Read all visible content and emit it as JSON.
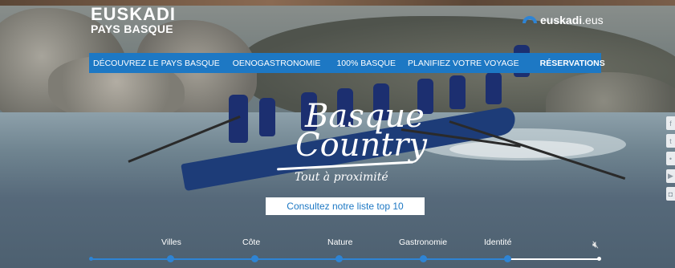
{
  "brand": {
    "line1": "EUSKADI",
    "line2": "PAYS BASQUE"
  },
  "site_link": {
    "bold": "euskadi",
    "suffix": ".eus",
    "color": "#2e84d4"
  },
  "nav": {
    "color": "#1d78c4",
    "items": [
      {
        "label": "DÉCOUVREZ LE PAYS BASQUE",
        "bold": false
      },
      {
        "label": "OENOGASTRONOMIE",
        "bold": false
      },
      {
        "label": "100% BASQUE",
        "bold": false
      },
      {
        "label": "PLANIFIEZ VOTRE VOYAGE",
        "bold": false
      },
      {
        "label": "RÉSERVATIONS",
        "bold": true
      }
    ]
  },
  "hero": {
    "title_line1": "Basque",
    "title_line2": "Country",
    "tagline": "Tout à proximité"
  },
  "cta": {
    "label": "Consultez notre liste top 10"
  },
  "timeline": {
    "items": [
      "Villes",
      "Côte",
      "Nature",
      "Gastronomie",
      "Identité"
    ],
    "mute_icon": "speaker-mute-icon"
  },
  "social": {
    "icons": [
      "facebook-icon",
      "twitter-icon",
      "flickr-icon",
      "youtube-icon",
      "instagram-icon"
    ]
  }
}
